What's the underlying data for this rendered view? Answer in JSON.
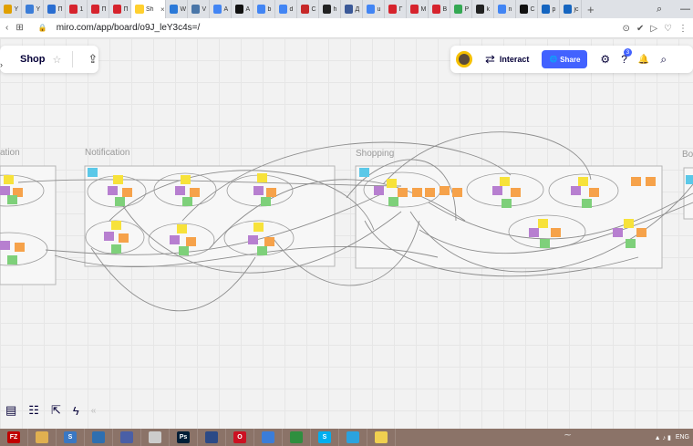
{
  "browser": {
    "tabs": [
      {
        "title": "Y",
        "color": "#e0a000"
      },
      {
        "title": "Y",
        "color": "#3b7dd8"
      },
      {
        "title": "П",
        "color": "#2a6ed1"
      },
      {
        "title": "1",
        "color": "#d6232d"
      },
      {
        "title": "П",
        "color": "#d6232d"
      },
      {
        "title": "П",
        "color": "#d6232d"
      },
      {
        "title": "Sh",
        "color": "#ffd02f",
        "active": true
      },
      {
        "title": "W",
        "color": "#2b79d8"
      },
      {
        "title": "V",
        "color": "#4a76a8"
      },
      {
        "title": "A",
        "color": "#4285f4"
      },
      {
        "title": "A",
        "color": "#111111"
      },
      {
        "title": "b",
        "color": "#4285f4"
      },
      {
        "title": "d",
        "color": "#4285f4"
      },
      {
        "title": "C",
        "color": "#c62828"
      },
      {
        "title": "h",
        "color": "#222222"
      },
      {
        "title": "Д",
        "color": "#3b5998"
      },
      {
        "title": "u",
        "color": "#4285f4"
      },
      {
        "title": "Г",
        "color": "#d6232d"
      },
      {
        "title": "M",
        "color": "#d6232d"
      },
      {
        "title": "B",
        "color": "#d6232d"
      },
      {
        "title": "P",
        "color": "#34a853"
      },
      {
        "title": "k",
        "color": "#222222"
      },
      {
        "title": "n",
        "color": "#4285f4"
      },
      {
        "title": "C",
        "color": "#111111"
      },
      {
        "title": "p",
        "color": "#1565c0"
      },
      {
        "title": "jc",
        "color": "#1565c0"
      }
    ],
    "close_tab": "×",
    "new_tab": "+",
    "window_controls": {
      "search": "⌕",
      "minimize": "—"
    },
    "url": "miro.com/app/board/o9J_leY3c4s=/",
    "address_icons": {
      "back": "‹",
      "lock": "🔒",
      "apps": "⊞"
    },
    "toolbar_icons": [
      "⊙",
      "✔",
      "▷",
      "♡",
      "⋮"
    ]
  },
  "miro": {
    "board_name": "Shop",
    "star": "☆",
    "upload_icon": "⇪",
    "interact_icon": "⇄",
    "interact_label": "Interact",
    "share_icon": "🌐",
    "share_label": "Share",
    "filter_icon": "⚙",
    "help_icon": "?",
    "help_badge": "3",
    "bell_icon": "🔔",
    "search_icon": "⌕",
    "frames": [
      {
        "label": "ation"
      },
      {
        "label": "Notification"
      },
      {
        "label": "Shopping"
      },
      {
        "label": "Bo"
      }
    ],
    "bottom_tools": {
      "comment": "▤",
      "layout": "☷",
      "share_screen": "⇱",
      "flash": "ϟ",
      "collapse": "«"
    }
  },
  "taskbar": {
    "apps": [
      {
        "name": "filezilla",
        "color": "#c00000",
        "label": "FZ"
      },
      {
        "name": "explorer",
        "color": "#e0b050",
        "label": ""
      },
      {
        "name": "app3",
        "color": "#3a78c3",
        "label": "S"
      },
      {
        "name": "app4",
        "color": "#2e6fb0",
        "label": ""
      },
      {
        "name": "app5",
        "color": "#4a5fa6",
        "label": ""
      },
      {
        "name": "app6",
        "color": "#cccccc",
        "label": ""
      },
      {
        "name": "photoshop",
        "color": "#001e36",
        "label": "Ps"
      },
      {
        "name": "app8",
        "color": "#2c4a86",
        "label": ""
      },
      {
        "name": "opera",
        "color": "#cc1122",
        "label": "O"
      },
      {
        "name": "app10",
        "color": "#3b7dd8",
        "label": ""
      },
      {
        "name": "app11",
        "color": "#2f8f3f",
        "label": ""
      },
      {
        "name": "skype",
        "color": "#00aff0",
        "label": "S"
      },
      {
        "name": "telegram",
        "color": "#2aa3df",
        "label": ""
      },
      {
        "name": "notes",
        "color": "#f0d050",
        "label": ""
      }
    ],
    "language": "ENG",
    "tray_icons": "▲ ♪ ▮"
  }
}
